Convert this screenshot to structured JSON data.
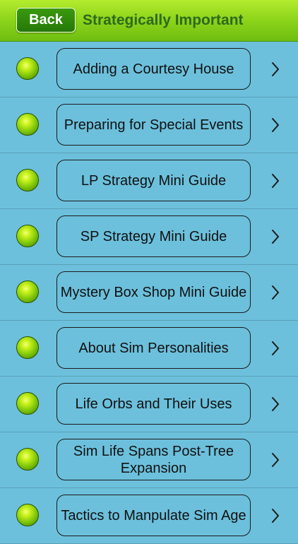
{
  "header": {
    "back_label": "Back",
    "title": "Strategically Important"
  },
  "items": [
    {
      "label": "Adding a Courtesy House"
    },
    {
      "label": "Preparing for Special Events"
    },
    {
      "label": "LP Strategy Mini Guide"
    },
    {
      "label": "SP Strategy Mini Guide"
    },
    {
      "label": "Mystery Box Shop Mini Guide"
    },
    {
      "label": "About Sim Personalities"
    },
    {
      "label": "Life Orbs and Their Uses"
    },
    {
      "label": "Sim Life Spans Post-Tree Expansion"
    },
    {
      "label": "Tactics to Manpulate Sim Age"
    }
  ],
  "colors": {
    "background": "#6cc0dc",
    "nav_green": "#8fd61c",
    "title_text": "#2e6a1c"
  },
  "icons": {
    "orb": "green-orb-icon",
    "chevron": "chevron-right-icon"
  }
}
